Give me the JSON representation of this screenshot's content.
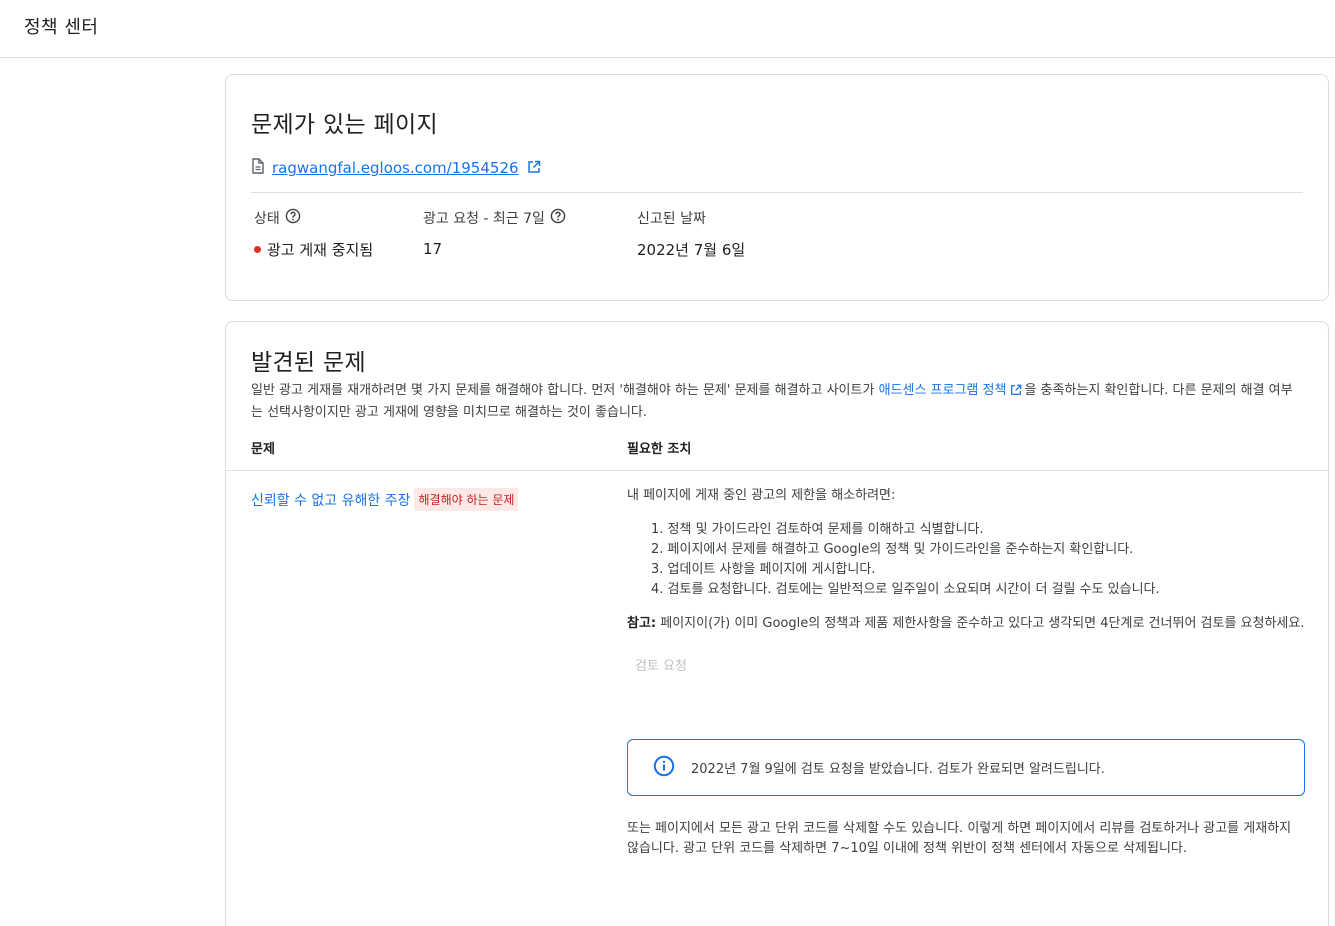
{
  "header": {
    "title": "정책 센터"
  },
  "page_card": {
    "title": "문제가 있는 페이지",
    "url": "ragwangfal.egloos.com/1954526",
    "stats": {
      "status_label": "상태",
      "status_value": "광고 게재 중지됨",
      "requests_label": "광고 요청 - 최근 7일",
      "requests_value": "17",
      "reported_label": "신고된 날짜",
      "reported_value": "2022년 7월 6일"
    },
    "status_color": "#d93025"
  },
  "issues_card": {
    "title": "발견된 문제",
    "desc_before": "일반 광고 게재를 재개하려면 몇 가지 문제를 해결해야 합니다. 먼저 '해결해야 하는 문제' 문제를 해결하고 사이트가 ",
    "desc_link": "애드센스 프로그램 정책",
    "desc_after": "을 충족하는지 확인합니다. 다른 문제의 해결 여부는 선택사항이지만 광고 게재에 영향을 미치므로 해결하는 것이 좋습니다.",
    "col_issue": "문제",
    "col_action": "필요한 조치",
    "issue": {
      "name": "신뢰할 수 없고 유해한 주장",
      "badge": "해결해야 하는 문제",
      "action_intro": "내 페이지에 게재 중인 광고의 제한을 해소하려면:",
      "steps": [
        "1. 정책 및 가이드라인 검토하여 문제를 이해하고 식별합니다.",
        "2. 페이지에서 문제를 해결하고 Google의 정책 및 가이드라인을 준수하는지 확인합니다.",
        "3. 업데이트 사항을 페이지에 게시합니다.",
        "4. 검토를 요청합니다. 검토에는 일반적으로 일주일이 소요되며 시간이 더 걸릴 수도 있습니다."
      ],
      "note_label": "참고:",
      "note_text": " 페이지이(가) 이미 Google의 정책과 제품 제한사항을 준수하고 있다고 생각되면 4단계로 건너뛰어 검토를 요청하세요.",
      "review_button": "검토 요청",
      "info_message": "2022년 7월 9일에 검토 요청을 받았습니다. 검토가 완료되면 알려드립니다.",
      "alt_text": "또는 페이지에서 모든 광고 단위 코드를 삭제할 수도 있습니다. 이렇게 하면 페이지에서 리뷰를 검토하거나 광고를 게재하지 않습니다. 광고 단위 코드를 삭제하면 7~10일 이내에 정책 위반이 정책 센터에서 자동으로 삭제됩니다."
    }
  },
  "colors": {
    "link": "#1a73e8",
    "badge_bg": "#fce8e6",
    "badge_text": "#c5221f"
  }
}
